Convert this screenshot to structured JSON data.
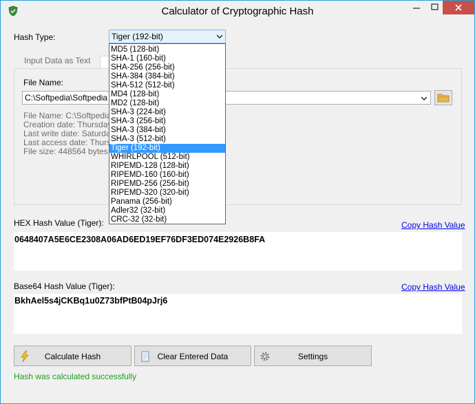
{
  "window": {
    "title": "Calculator of Cryptographic Hash"
  },
  "hash_type": {
    "label": "Hash Type:",
    "selected": "Tiger (192-bit)",
    "options": [
      "MD5 (128-bit)",
      "SHA-1 (160-bit)",
      "SHA-256 (256-bit)",
      "SHA-384 (384-bit)",
      "SHA-512 (512-bit)",
      "MD4 (128-bit)",
      "MD2 (128-bit)",
      "SHA-3 (224-bit)",
      "SHA-3 (256-bit)",
      "SHA-3 (384-bit)",
      "SHA-3 (512-bit)",
      "Tiger (192-bit)",
      "WHIRLPOOL (512-bit)",
      "RIPEMD-128 (128-bit)",
      "RIPEMD-160 (160-bit)",
      "RIPEMD-256 (256-bit)",
      "RIPEMD-320 (320-bit)",
      "Panama (256-bit)",
      "Adler32 (32-bit)",
      "CRC-32 (32-bit)"
    ],
    "selected_index": 11
  },
  "tabs": {
    "text_tab": "Input Data as Text"
  },
  "file": {
    "label": "File Name:",
    "path": "C:\\Softpedia\\Softpedia T",
    "info": [
      "File Name: C:\\Softpedia\\S",
      "Creation date: Thursday, C",
      "Last write date: Saturday,",
      "Last access date: Thursde",
      "File size: 448564 bytes"
    ]
  },
  "hex": {
    "label": "HEX Hash Value (Tiger):",
    "value": "0648407A5E6CE2308A06AD6ED19EF76DF3ED074E2926B8FA",
    "copy": "Copy Hash Value"
  },
  "base64": {
    "label": "Base64 Hash Value (Tiger):",
    "value": "BkhAel5s4jCKBq1u0Z73bfPtB04pJrj6",
    "copy": "Copy Hash Value"
  },
  "buttons": {
    "calculate": "Calculate Hash",
    "clear": "Clear Entered Data",
    "settings": "Settings"
  },
  "status": "Hash was calculated successfully",
  "colors": {
    "accent": "#3399ff",
    "status_green": "#1a9e1a",
    "link": "#0000ee",
    "close": "#c7504b"
  },
  "icons": [
    "shield-icon",
    "folder-icon",
    "lightning-icon",
    "eraser-icon",
    "gear-icon"
  ]
}
